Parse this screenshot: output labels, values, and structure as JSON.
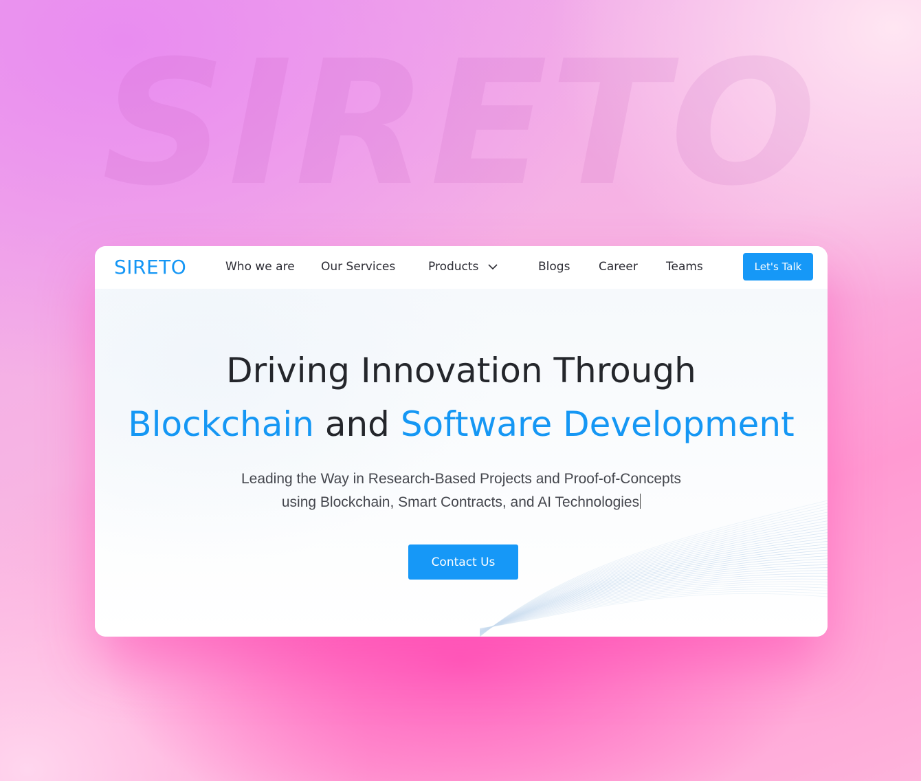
{
  "background": {
    "watermark_text": "SIRETO"
  },
  "colors": {
    "accent": "#1698f7",
    "heading": "#24262b",
    "backdrop_pink": "#ff5fbd"
  },
  "navbar": {
    "logo": "SIRETO",
    "items": [
      {
        "label": "Who we are"
      },
      {
        "label": "Our Services"
      },
      {
        "label": "Products",
        "icon": "chevron-down-icon"
      },
      {
        "label": "Blogs"
      },
      {
        "label": "Career"
      },
      {
        "label": "Teams"
      }
    ],
    "cta_label": "Let's Talk"
  },
  "hero": {
    "line1": "Driving Innovation Through",
    "line2_part1": "Blockchain",
    "line2_part2": "and",
    "line2_part3": "Software Development",
    "sub_line1": "Leading the Way in Research-Based Projects and Proof-of-Concepts",
    "sub_line2": "using Blockchain, Smart Contracts, and AI Technologies",
    "cta_label": "Contact Us"
  }
}
